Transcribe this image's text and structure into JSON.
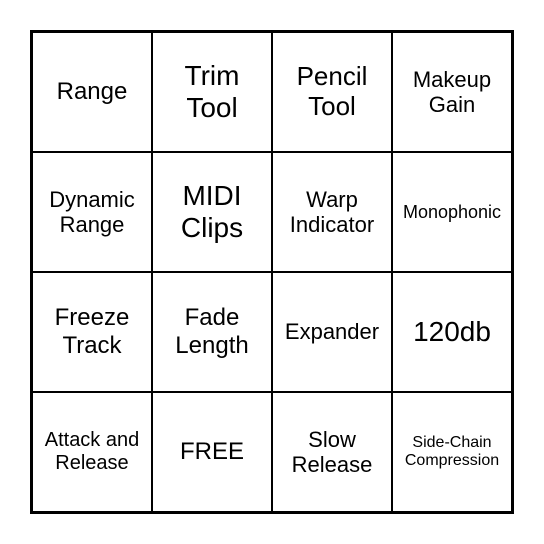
{
  "grid": {
    "cells": [
      {
        "label": "Range",
        "size": "fs-24"
      },
      {
        "label": "Trim Tool",
        "size": "fs-28"
      },
      {
        "label": "Pencil Tool",
        "size": "fs-26"
      },
      {
        "label": "Makeup Gain",
        "size": "fs-22"
      },
      {
        "label": "Dynamic Range",
        "size": "fs-22"
      },
      {
        "label": "MIDI Clips",
        "size": "fs-28"
      },
      {
        "label": "Warp Indicator",
        "size": "fs-22"
      },
      {
        "label": "Monophonic",
        "size": "fs-18"
      },
      {
        "label": "Freeze Track",
        "size": "fs-24"
      },
      {
        "label": "Fade Length",
        "size": "fs-24"
      },
      {
        "label": "Expander",
        "size": "fs-22"
      },
      {
        "label": "120db",
        "size": "fs-28"
      },
      {
        "label": "Attack and Release",
        "size": "fs-20"
      },
      {
        "label": "FREE",
        "size": "fs-24"
      },
      {
        "label": "Slow Release",
        "size": "fs-22"
      },
      {
        "label": "Side-Chain Compression",
        "size": "fs-16"
      }
    ]
  }
}
